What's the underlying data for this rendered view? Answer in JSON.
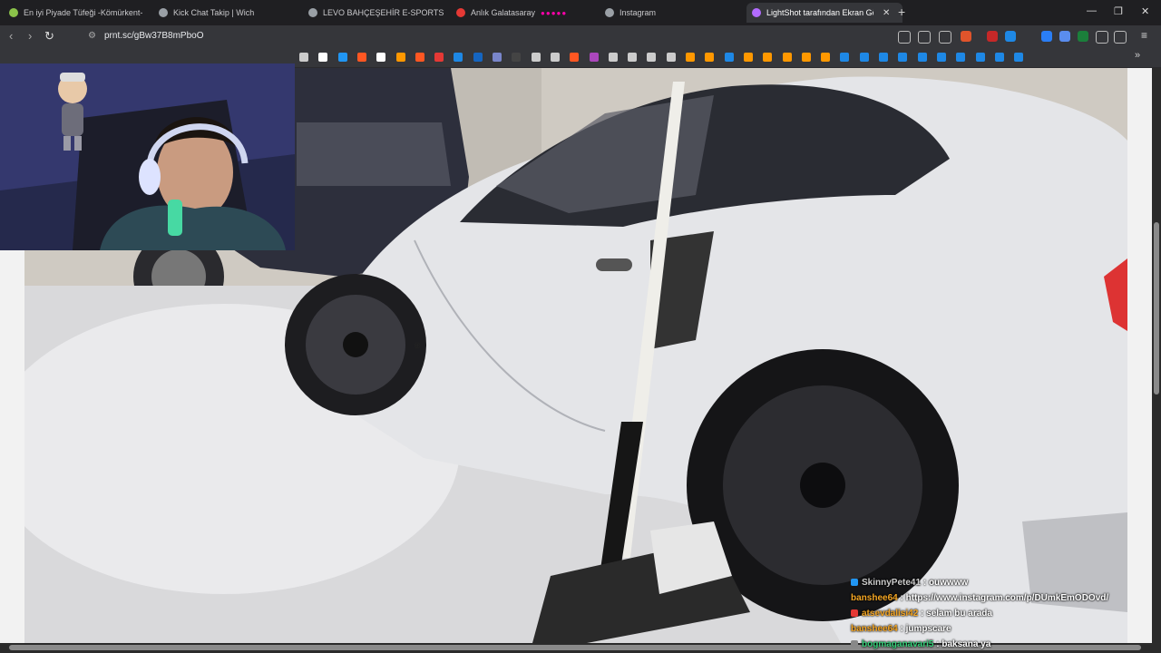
{
  "tabs": [
    {
      "label": "En iyi Piyade Tüfeği -Kömürkent- (ist",
      "active": false
    },
    {
      "label": "Kick Chat Takip | Wich",
      "active": false
    },
    {
      "label": "LEVO BAHÇEŞEHİR E-SPORTS OYUN",
      "active": false
    },
    {
      "label": "Anlık Galatasaray",
      "active": false
    },
    {
      "label": "Instagram",
      "active": false
    },
    {
      "label": "LightShot tarafından Ekran Görü",
      "active": true
    }
  ],
  "new_tab_label": "+",
  "address_bar": {
    "url": "prnt.sc/gBw37B8mPboO"
  },
  "colors": {
    "brand_accent": "#f5a623",
    "chat_user": "#f5a623",
    "chat_user_alt": "#36d17a"
  },
  "chat": [
    {
      "user": "SkinnyPete41",
      "message": "ouwwww"
    },
    {
      "user": "banshee64",
      "message": "https://www.instagram.com/p/DUmkEmODOvd/"
    },
    {
      "user": "atsevdalisi42",
      "message": "selam bu arada"
    },
    {
      "user": "banshee64",
      "message": "jumpscare"
    },
    {
      "user": "bogmaganavari5",
      "message": "baksana ya"
    }
  ],
  "icons": {
    "back": "arrow-left-icon",
    "forward": "arrow-right-icon",
    "reload": "reload-icon",
    "zoom_cursor": "zoom-in-icon",
    "menu": "menu-icon"
  }
}
